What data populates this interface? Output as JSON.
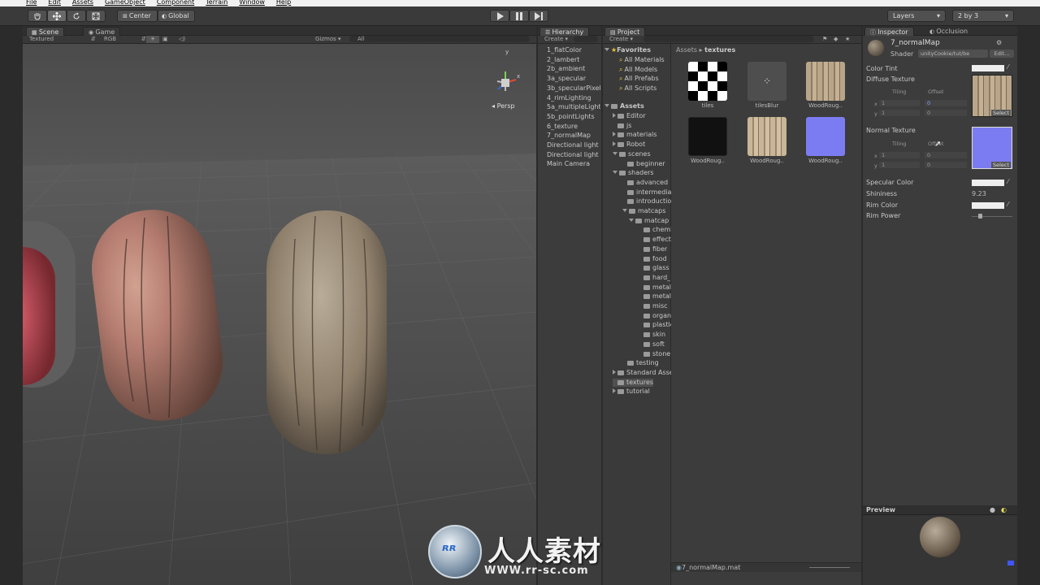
{
  "menubar": [
    "File",
    "Edit",
    "Assets",
    "GameObject",
    "Component",
    "Terrain",
    "Window",
    "Help"
  ],
  "toolbar": {
    "pivot": "Center",
    "space": "Global",
    "layers": "Layers",
    "layout": "2 by 3"
  },
  "scene": {
    "tab_scene": "Scene",
    "tab_game": "Game",
    "render_mode": "Textured",
    "color_mode": "RGB",
    "gizmos": "Gizmos",
    "search": "All",
    "gizmo_y": "y",
    "gizmo_x": "x",
    "persp": "Persp"
  },
  "hierarchy": {
    "tab": "Hierarchy",
    "create": "Create",
    "items": [
      "1_flatColor",
      "2_lambert",
      "2b_ambient",
      "3a_specular",
      "3b_specularPixel",
      "4_rimLighting",
      "5a_multipleLights",
      "5b_pointLights",
      "6_texture",
      "7_normalMap",
      "Directional light",
      "Directional light",
      "Main Camera"
    ]
  },
  "project": {
    "tab": "Project",
    "create": "Create",
    "favorites_title": "Favorites",
    "favorites": [
      "All Materials",
      "All Models",
      "All Prefabs",
      "All Scripts"
    ],
    "assets_title": "Assets",
    "tree": [
      {
        "label": "Editor"
      },
      {
        "label": "js"
      },
      {
        "label": "materials"
      },
      {
        "label": "Robot"
      },
      {
        "label": "scenes"
      },
      {
        "label": "beginner"
      },
      {
        "label": "shaders"
      },
      {
        "label": "advanced"
      },
      {
        "label": "intermediate"
      },
      {
        "label": "introduction"
      },
      {
        "label": "matcaps"
      },
      {
        "label": "matcap"
      },
      {
        "label": "chemical"
      },
      {
        "label": "effects"
      },
      {
        "label": "fiber"
      },
      {
        "label": "food"
      },
      {
        "label": "glass"
      },
      {
        "label": "hard_"
      },
      {
        "label": "metal"
      },
      {
        "label": "metal"
      },
      {
        "label": "misc"
      },
      {
        "label": "organic"
      },
      {
        "label": "plastic"
      },
      {
        "label": "skin"
      },
      {
        "label": "soft"
      },
      {
        "label": "stone"
      },
      {
        "label": "testing"
      },
      {
        "label": "Standard Assets"
      },
      {
        "label": "textures"
      },
      {
        "label": "tutorial"
      }
    ],
    "breadcrumb_root": "Assets",
    "breadcrumb_current": "textures",
    "thumbs": [
      "tiles",
      "tilesBlur",
      "WoodRoug..",
      "WoodRoug..",
      "WoodRoug..",
      "WoodRoug.."
    ],
    "footer_file": "7_normalMap.mat"
  },
  "inspector": {
    "tab": "Inspector",
    "tab2": "Occlusion",
    "material_name": "7_normalMap",
    "shader_label": "Shader",
    "shader_value": "unityCookie/tut/be",
    "edit": "Edit...",
    "color_tint": "Color Tint",
    "diffuse": "Diffuse Texture",
    "tiling": "Tiling",
    "offset": "Offset",
    "x": "x",
    "y": "y",
    "tile_x": "1",
    "tile_y": "1",
    "off_x": "0",
    "off_y": "0",
    "select": "Select",
    "normal": "Normal Texture",
    "specular_color": "Specular Color",
    "shininess": "Shininess",
    "shininess_value": "9.23",
    "rim_color": "Rim Color",
    "rim_power": "Rim Power",
    "preview": "Preview"
  },
  "watermark": {
    "cn": "人人素材",
    "url": "WWW.rr-sc.com"
  },
  "colors": {
    "normal_map": "#7c7cf2",
    "panel": "#3c3c3c"
  }
}
